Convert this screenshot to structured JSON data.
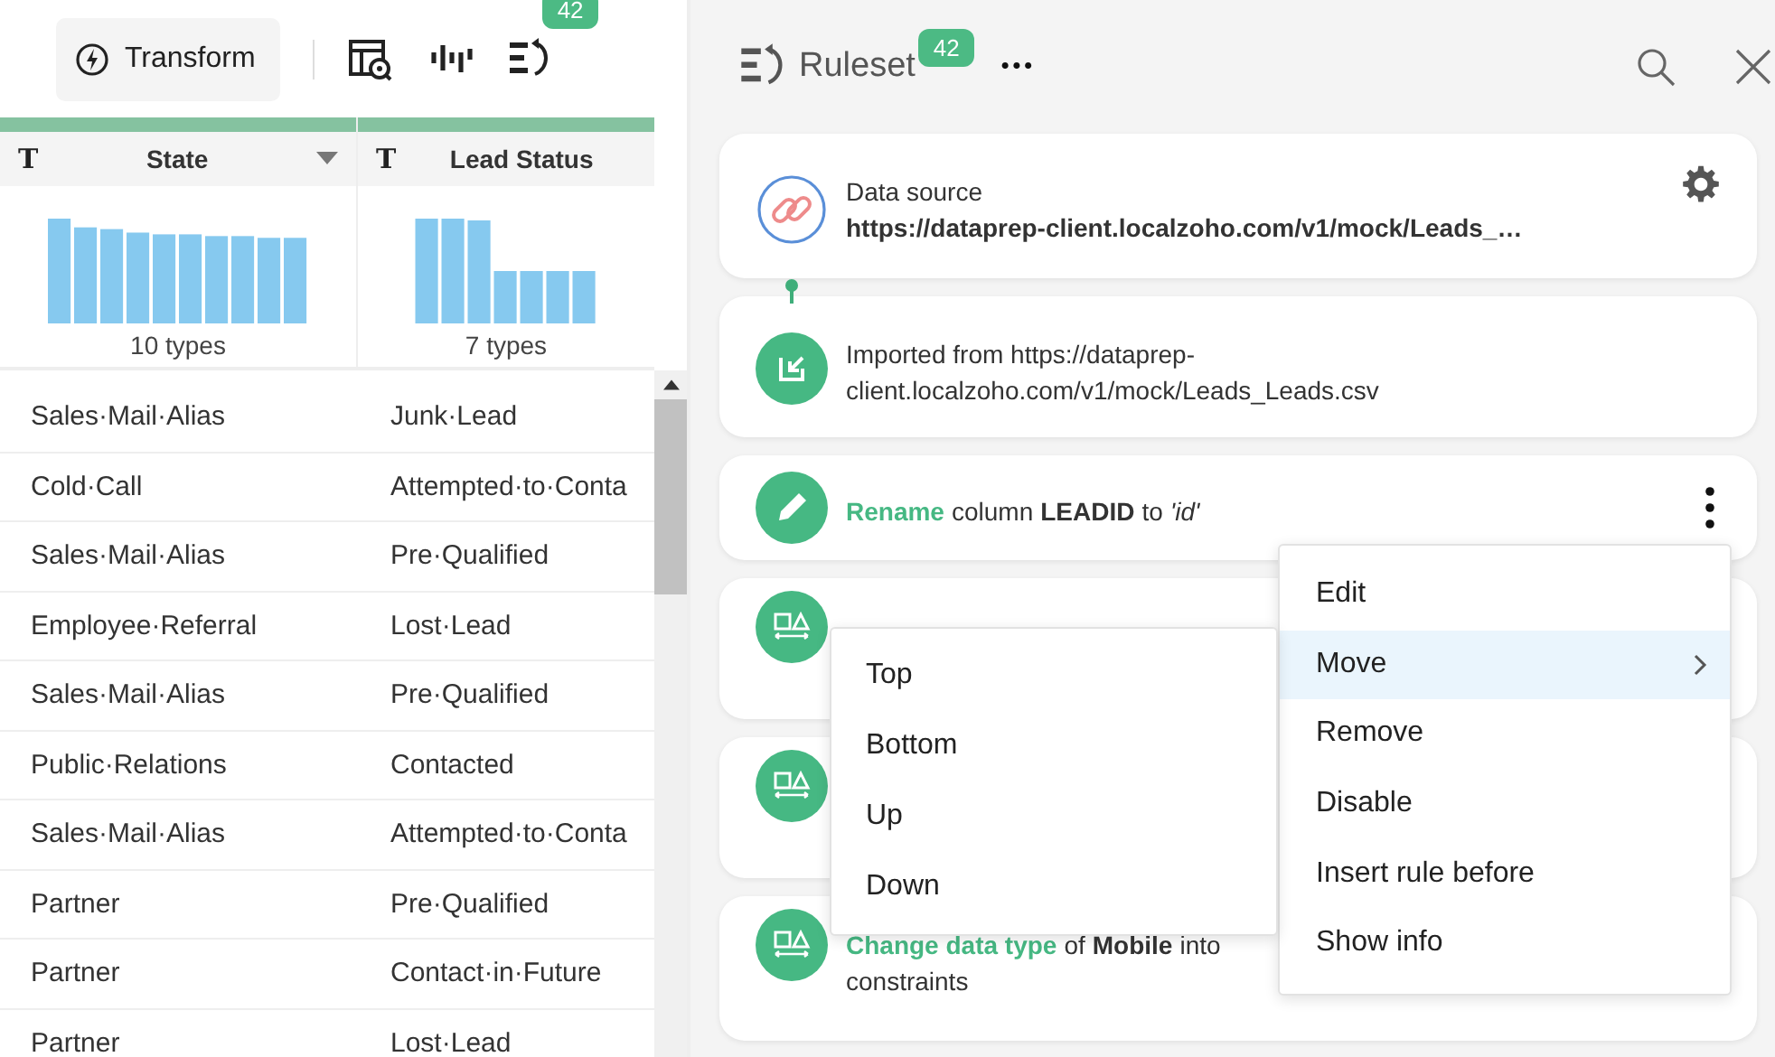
{
  "toolbar": {
    "transform_label": "Transform",
    "badge": "42"
  },
  "table": {
    "columns": [
      {
        "name": "State",
        "type_icon": "T",
        "summary": "10 types",
        "sortable": true
      },
      {
        "name": "Lead Status",
        "type_icon": "T",
        "summary": "7 types",
        "sortable": false
      }
    ],
    "rows": [
      [
        "Sales·Mail·Alias",
        "Junk·Lead"
      ],
      [
        "Cold·Call",
        "Attempted·to·Conta"
      ],
      [
        "Sales·Mail·Alias",
        "Pre·Qualified"
      ],
      [
        "Employee·Referral",
        "Lost·Lead"
      ],
      [
        "Sales·Mail·Alias",
        "Pre·Qualified"
      ],
      [
        "Public·Relations",
        "Contacted"
      ],
      [
        "Sales·Mail·Alias",
        "Attempted·to·Conta"
      ],
      [
        "Partner",
        "Pre·Qualified"
      ],
      [
        "Partner",
        "Contact·in·Future"
      ],
      [
        "Partner",
        "Lost·Lead"
      ]
    ]
  },
  "ruleset": {
    "title": "Ruleset",
    "badge": "42",
    "more": "•••",
    "rules": [
      {
        "kind": "source",
        "lines": [
          "Data source",
          "**https://dataprep-client.localzoho.com/v1/mock/Leads_…**"
        ]
      },
      {
        "kind": "import",
        "lines": [
          "Imported from https://dataprep-",
          "client.localzoho.com/v1/mock/Leads_Leads.csv"
        ]
      },
      {
        "kind": "rename",
        "parts": [
          {
            "kind": "action",
            "text": "Rename"
          },
          {
            "kind": "plain",
            "text": "column"
          },
          {
            "kind": "bold",
            "text": "LEADID"
          },
          {
            "kind": "plain",
            "text": "to"
          },
          {
            "kind": "italic",
            "text": "'id'"
          }
        ]
      },
      {
        "kind": "datatype"
      },
      {
        "kind": "datatype"
      },
      {
        "kind": "datatype",
        "parts": [
          {
            "kind": "action",
            "text": "Change data type"
          },
          {
            "kind": "plain",
            "text": "of"
          },
          {
            "kind": "bold",
            "text": "Mobile"
          },
          {
            "kind": "plain",
            "text": "into"
          }
        ],
        "lines": [
          "constraints"
        ]
      }
    ]
  },
  "context_menu": {
    "items": [
      {
        "label": "Edit",
        "selected": false,
        "submenu": false
      },
      {
        "label": "Move",
        "selected": true,
        "submenu": true
      },
      {
        "label": "Remove",
        "selected": false,
        "submenu": false
      },
      {
        "label": "Disable",
        "selected": false,
        "submenu": false
      },
      {
        "label": "Insert rule before",
        "selected": false,
        "submenu": false
      },
      {
        "label": "Show info",
        "selected": false,
        "submenu": false
      }
    ]
  },
  "submenu": {
    "items": [
      "Top",
      "Bottom",
      "Up",
      "Down"
    ]
  }
}
